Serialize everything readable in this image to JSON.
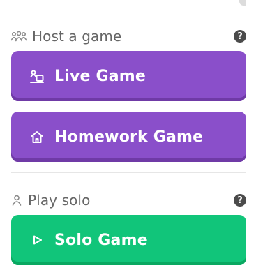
{
  "sections": {
    "host": {
      "title": "Host a game",
      "help_icon": "?",
      "icon": "group-icon"
    },
    "solo": {
      "title": "Play solo",
      "help_icon": "?",
      "icon": "user-icon"
    }
  },
  "buttons": {
    "live_game": {
      "label": "Live Game",
      "icon": "live-game-icon"
    },
    "homework_game": {
      "label": "Homework Game",
      "icon": "home-icon"
    },
    "solo_game": {
      "label": "Solo Game",
      "icon": "play-icon"
    }
  },
  "colors": {
    "purple": "#8a4fca",
    "purple_dark": "#6f3aa6",
    "green": "#11c57a",
    "green_dark": "#0aa861",
    "header_text": "#666666"
  }
}
